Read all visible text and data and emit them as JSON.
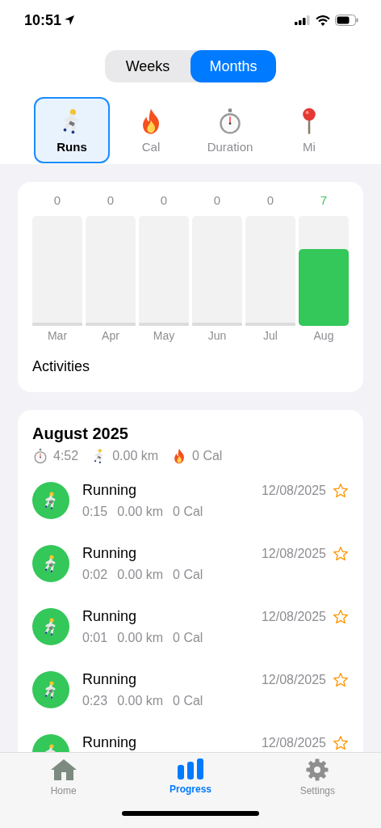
{
  "status_bar": {
    "time": "10:51"
  },
  "segments": [
    {
      "label": "Weeks",
      "selected": false
    },
    {
      "label": "Months",
      "selected": true
    }
  ],
  "metrics": [
    {
      "label": "Runs",
      "kind": "runner",
      "selected": true
    },
    {
      "label": "Cal",
      "kind": "fire",
      "selected": false
    },
    {
      "label": "Duration",
      "kind": "stopwatch",
      "selected": false
    },
    {
      "label": "Mi",
      "kind": "pin",
      "selected": false
    }
  ],
  "chart_card": {
    "bars": [
      {
        "label": "Mar",
        "value": "0",
        "level": 0
      },
      {
        "label": "Apr",
        "value": "0",
        "level": 0
      },
      {
        "label": "May",
        "value": "0",
        "level": 0
      },
      {
        "label": "Jun",
        "value": "0",
        "level": 0
      },
      {
        "label": "Jul",
        "value": "0",
        "level": 0
      },
      {
        "label": "Aug",
        "value": "7",
        "level": 0.7
      }
    ],
    "title": "Activities"
  },
  "summary": {
    "title": "August 2025",
    "stats": [
      {
        "kind": "stopwatch",
        "text": "4:52"
      },
      {
        "kind": "runner",
        "text": "0.00 km"
      },
      {
        "kind": "fire",
        "text": "0 Cal"
      }
    ]
  },
  "activities": [
    {
      "title": "Running",
      "date": "12/08/2025",
      "starred": false,
      "stats": [
        "0:15",
        "0.00 km",
        "0 Cal"
      ]
    },
    {
      "title": "Running",
      "date": "12/08/2025",
      "starred": false,
      "stats": [
        "0:02",
        "0.00 km",
        "0 Cal"
      ]
    },
    {
      "title": "Running",
      "date": "12/08/2025",
      "starred": false,
      "stats": [
        "0:01",
        "0.00 km",
        "0 Cal"
      ]
    },
    {
      "title": "Running",
      "date": "12/08/2025",
      "starred": false,
      "stats": [
        "0:23",
        "0.00 km",
        "0 Cal"
      ]
    },
    {
      "title": "Running",
      "date": "12/08/2025",
      "starred": false
    }
  ],
  "tab_bar": [
    {
      "label": "Home",
      "kind": "home",
      "selected": false
    },
    {
      "label": "Progress",
      "kind": "progress",
      "selected": true
    },
    {
      "label": "Settings",
      "kind": "settings",
      "selected": false
    }
  ]
}
